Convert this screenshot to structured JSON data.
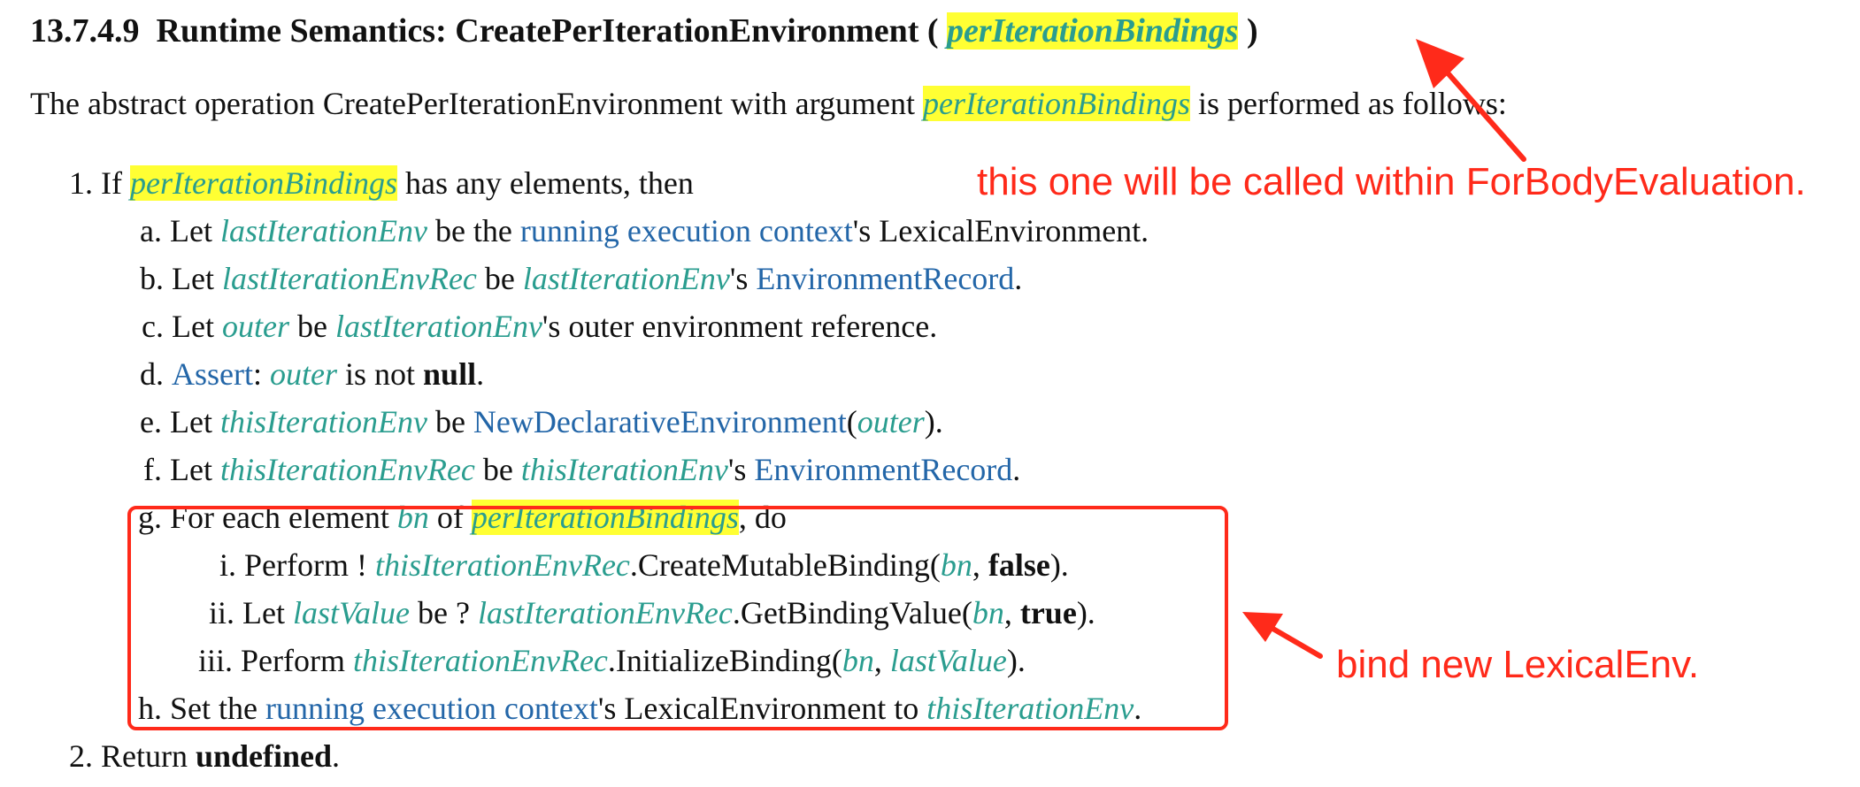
{
  "heading": {
    "number": "13.7.4.9",
    "title": "Runtime Semantics: CreatePerIterationEnvironment ( ",
    "param": "perIterationBindings",
    "close": " )"
  },
  "intro": {
    "before": "The abstract operation CreatePerIterationEnvironment with argument ",
    "param": "perIterationBindings",
    "after": " is performed as follows:"
  },
  "steps": {
    "s1": {
      "num": "1.",
      "t1": " If ",
      "v1": "perIterationBindings",
      "t2": " has any elements, then"
    },
    "a": {
      "num": "a.",
      "t1": " Let ",
      "v1": "lastIterationEnv",
      "t2": " be the ",
      "l1": "running execution context",
      "t3": "'s LexicalEnvironment."
    },
    "b": {
      "num": "b.",
      "t1": " Let ",
      "v1": "lastIterationEnvRec",
      "t2": " be ",
      "v2": "lastIterationEnv",
      "t3": "'s ",
      "l1": "EnvironmentRecord",
      "t4": "."
    },
    "c": {
      "num": "c.",
      "t1": " Let ",
      "v1": "outer",
      "t2": " be ",
      "v2": "lastIterationEnv",
      "t3": "'s outer environment reference."
    },
    "d": {
      "num": "d.",
      "l1": "Assert",
      "t1": ": ",
      "v1": "outer",
      "t2": " is not ",
      "b1": "null",
      "t3": "."
    },
    "e": {
      "num": "e.",
      "t1": " Let ",
      "v1": "thisIterationEnv",
      "t2": " be ",
      "l1": "NewDeclarativeEnvironment",
      "t3": "(",
      "v2": "outer",
      "t4": ")."
    },
    "f": {
      "num": "f.",
      "t1": " Let ",
      "v1": "thisIterationEnvRec",
      "t2": " be ",
      "v2": "thisIterationEnv",
      "t3": "'s ",
      "l1": "EnvironmentRecord",
      "t4": "."
    },
    "g": {
      "num": "g.",
      "t1": " For each element ",
      "v1": "bn",
      "t2": " of ",
      "v2": "perIterationBindings",
      "t3": ", do"
    },
    "gi": {
      "num": "i.",
      "t1": " Perform ! ",
      "v1": "thisIterationEnvRec",
      "t2": ".CreateMutableBinding(",
      "v2": "bn",
      "t3": ", ",
      "b1": "false",
      "t4": ")."
    },
    "gii": {
      "num": "ii.",
      "t1": " Let ",
      "v1": "lastValue",
      "t2": " be ? ",
      "v2": "lastIterationEnvRec",
      "t3": ".GetBindingValue(",
      "v3": "bn",
      "t4": ", ",
      "b1": "true",
      "t5": ")."
    },
    "giii": {
      "num": "iii.",
      "t1": " Perform ",
      "v1": "thisIterationEnvRec",
      "t2": ".InitializeBinding(",
      "v2": "bn",
      "t3": ", ",
      "v3": "lastValue",
      "t4": ")."
    },
    "h": {
      "num": "h.",
      "t1": " Set the ",
      "l1": "running execution context",
      "t2": "'s LexicalEnvironment to ",
      "v1": "thisIterationEnv",
      "t3": "."
    },
    "s2": {
      "num": "2.",
      "t1": " Return ",
      "b1": "undefined",
      "t2": "."
    }
  },
  "annotations": {
    "top": "this one will be called within ForBodyEvaluation.",
    "box": "bind new LexicalEnv."
  },
  "colors": {
    "variable": "#2a9d8f",
    "link": "#2366a8",
    "highlight": "#ffff33",
    "annotation": "#ff2a1a"
  }
}
